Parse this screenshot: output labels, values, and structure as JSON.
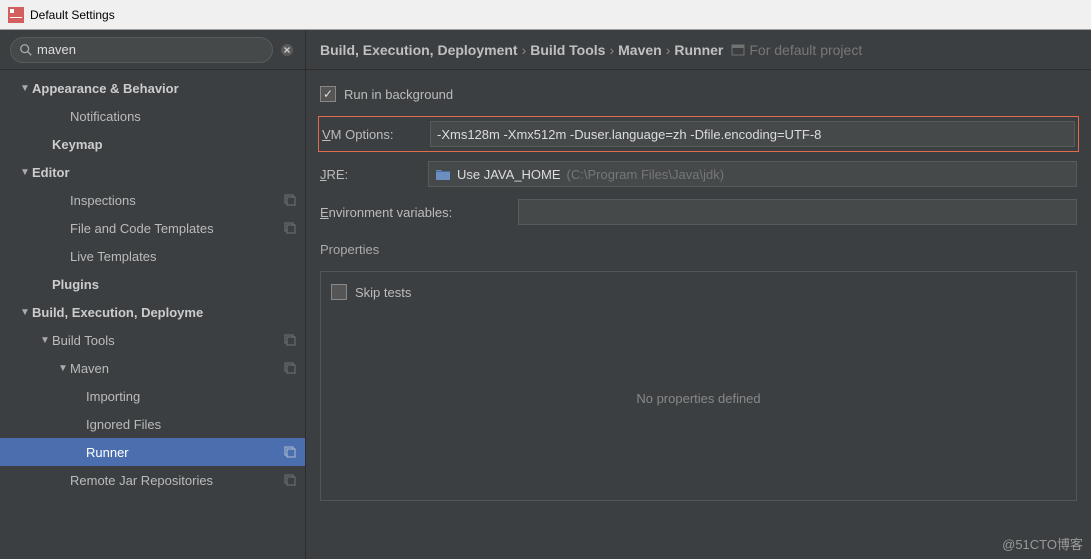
{
  "window": {
    "title": "Default Settings"
  },
  "search": {
    "value": "maven"
  },
  "tree": {
    "appearance": "Appearance & Behavior",
    "notifications": "Notifications",
    "keymap": "Keymap",
    "editor": "Editor",
    "inspections": "Inspections",
    "file_templates": "File and Code Templates",
    "live_templates": "Live Templates",
    "plugins": "Plugins",
    "bed": "Build, Execution, Deployme",
    "build_tools": "Build Tools",
    "maven": "Maven",
    "importing": "Importing",
    "ignored": "Ignored Files",
    "runner": "Runner",
    "remote": "Remote Jar Repositories"
  },
  "breadcrumb": {
    "a": "Build, Execution, Deployment",
    "sep": "›",
    "b": "Build Tools",
    "c": "Maven",
    "d": "Runner",
    "hint": "For default project"
  },
  "form": {
    "run_bg_prefix": "Run in ",
    "run_bg_u": "b",
    "run_bg_suffix": "ackground",
    "vm_label_u": "V",
    "vm_label_rest": "M Options:",
    "vm_value": "-Xms128m -Xmx512m -Duser.language=zh -Dfile.encoding=UTF-8",
    "jre_label_u": "J",
    "jre_label_rest": "RE:",
    "jre_value": "Use JAVA_HOME",
    "jre_hint": "(C:\\Program Files\\Java\\jdk)",
    "env_label_u": "E",
    "env_label_rest": "nvironment variables:",
    "env_value": "",
    "properties": "Properties",
    "skip_label_prefix": "Skip ",
    "skip_label_u": "t",
    "skip_label_suffix": "ests",
    "no_props": "No properties defined"
  },
  "watermark": "@51CTO博客"
}
